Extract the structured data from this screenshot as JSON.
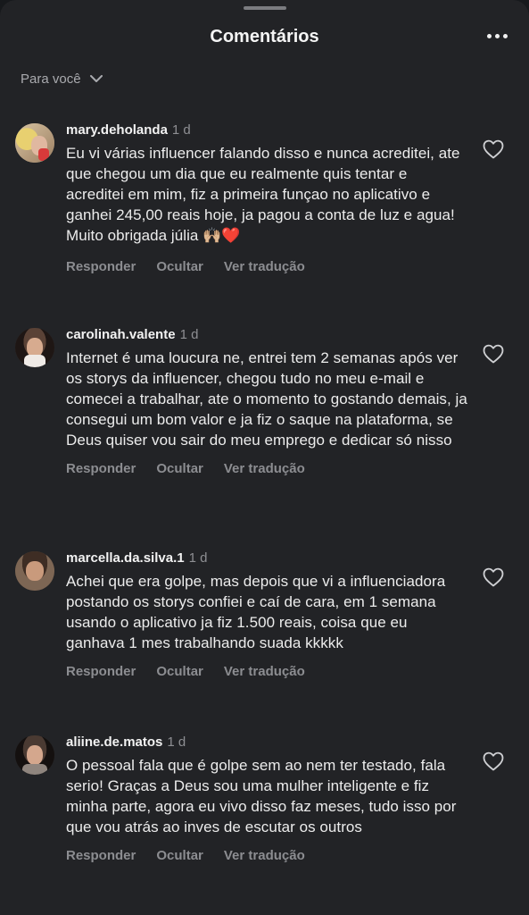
{
  "header": {
    "title": "Comentários",
    "more_icon": "more-horizontal-icon"
  },
  "sort": {
    "label": "Para você",
    "icon": "chevron-down-icon"
  },
  "actions": {
    "reply": "Responder",
    "hide": "Ocultar",
    "translate": "Ver tradução"
  },
  "comments": [
    {
      "user": "mary.deholanda",
      "time": "1 d",
      "text": "Eu vi várias influencer falando disso e nunca acreditei, ate que chegou um dia que eu realmente quis tentar e acreditei em mim, fiz a primeira funçao no aplicativo e ganhei 245,00 reais hoje, ja pagou a conta de luz e agua! Muito obrigada júlia",
      "emojis": "🙌🏼❤️",
      "avatar": "avatar-photo"
    },
    {
      "user": "carolinah.valente",
      "time": "1 d",
      "text": "Internet é uma loucura ne, entrei tem 2 semanas após ver os storys da influencer, chegou tudo no meu e-mail e comecei a trabalhar, ate o momento to gostando demais, ja consegui um bom valor e ja fiz o saque na plataforma, se Deus quiser vou sair do meu emprego e dedicar só nisso",
      "avatar": "avatar-photo"
    },
    {
      "user": "marcella.da.silva.1",
      "time": "1 d",
      "text": "Achei que era golpe, mas depois que vi a influenciadora postando os storys confiei e caí de cara, em 1 semana usando o aplicativo ja fiz 1.500 reais, coisa que eu ganhava 1 mes trabalhando suada kkkkk",
      "avatar": "avatar-photo"
    },
    {
      "user": "aliine.de.matos",
      "time": "1 d",
      "text": "O pessoal fala que é golpe sem ao nem ter testado, fala serio! Graças a Deus sou uma mulher inteligente e fiz minha parte, agora eu vivo disso faz meses, tudo isso por que vou atrás ao inves de escutar os outros",
      "avatar": "avatar-photo"
    }
  ],
  "colors": {
    "background": "#222326",
    "text": "#f2f2f2",
    "muted": "#8c8d91"
  }
}
